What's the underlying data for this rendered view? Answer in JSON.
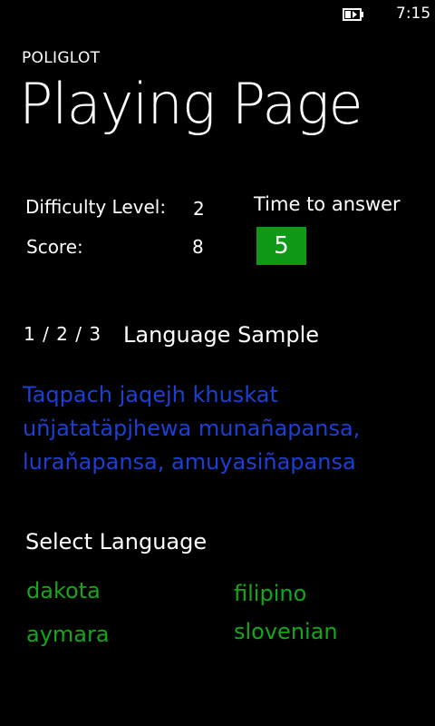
{
  "status_bar": {
    "time": "7:15",
    "battery_icon": "battery-charging-icon"
  },
  "app": {
    "name": "POLIGLOT",
    "page_title": "Playing Page"
  },
  "stats": {
    "difficulty_label": "Difficulty Level:",
    "difficulty_value": "2",
    "score_label": "Score:",
    "score_value": "8",
    "time_label": "Time to answer",
    "time_value": "5"
  },
  "progress": {
    "text": "1 / 2 / 3",
    "title": "Language Sample"
  },
  "sample_text": "Taqpach jaqejh khuskat uñjatatäpjhewa munañapansa, luraňapansa, amuyasiñapansa",
  "select": {
    "title": "Select Language",
    "options": [
      "dakota",
      "filipino",
      "aymara",
      "slovenian"
    ]
  },
  "colors": {
    "background": "#000000",
    "accent_green": "#0e9a17",
    "option_green": "#15a61c",
    "sample_blue": "#1c3fd6"
  }
}
